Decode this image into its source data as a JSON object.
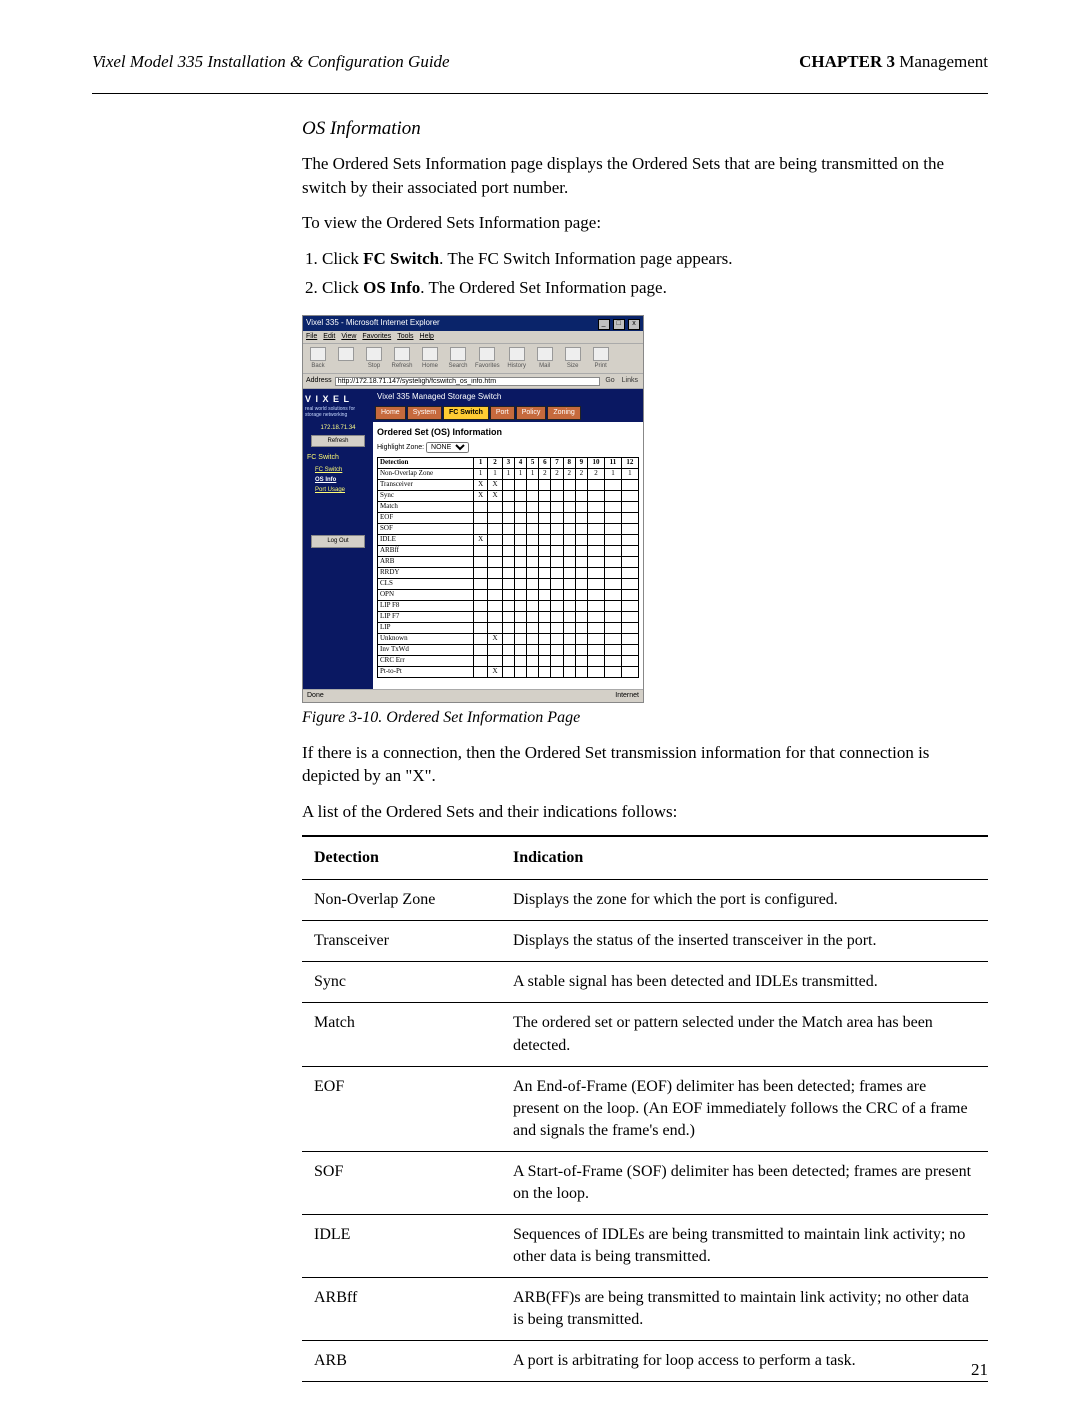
{
  "header": {
    "left": "Vixel Model 335 Installation & Configuration Guide",
    "right_bold": "CHAPTER 3",
    "right_rest": " Management"
  },
  "section_heading": "OS Information",
  "para1": "The Ordered Sets Information page displays the Ordered Sets that are being transmitted on the switch by their associated port number.",
  "para2": "To view the Ordered Sets Information page:",
  "steps": [
    {
      "pre": "Click ",
      "bold": "FC Switch",
      "post": ". The FC Switch Information page appears."
    },
    {
      "pre": "Click ",
      "bold": "OS Info",
      "post": ". The Ordered Set Information page."
    }
  ],
  "fig_caption": "Figure 3-10. Ordered Set Information Page",
  "para3": "If there is a connection, then the Ordered Set transmission information for that connection is depicted by an \"X\".",
  "para4": "A list of the Ordered Sets and their indications follows:",
  "ind_table": {
    "headers": [
      "Detection",
      "Indication"
    ],
    "rows": [
      [
        "Non-Overlap Zone",
        "Displays the zone for which the port is configured."
      ],
      [
        "Transceiver",
        "Displays the status of the inserted transceiver in the port."
      ],
      [
        "Sync",
        "A stable signal has been detected and IDLEs transmitted."
      ],
      [
        "Match",
        "The ordered set or pattern selected under the Match area has been detected."
      ],
      [
        "EOF",
        "An End-of-Frame (EOF) delimiter has been detected; frames are present on the loop. (An EOF immediately follows the CRC of a frame and signals the frame's end.)"
      ],
      [
        "SOF",
        "A Start-of-Frame (SOF) delimiter has been detected; frames are present on the loop."
      ],
      [
        "IDLE",
        "Sequences of IDLEs are being transmitted to maintain link activity; no other data is being transmitted."
      ],
      [
        "ARBff",
        "ARB(FF)s are being transmitted to maintain link activity; no other data is being transmitted."
      ],
      [
        "ARB",
        "A port is arbitrating for loop access to perform a task."
      ]
    ]
  },
  "page_number": "21",
  "screenshot": {
    "window_title": "Vixel 335 - Microsoft Internet Explorer",
    "menus": [
      "File",
      "Edit",
      "View",
      "Favorites",
      "Tools",
      "Help"
    ],
    "toolbar": [
      "Back",
      "",
      "Stop",
      "Refresh",
      "Home",
      "Search",
      "Favorites",
      "History",
      "Mail",
      "Size",
      "Print"
    ],
    "address_label": "Address",
    "address_url": "http://172.18.71.147/systeligh/fcswitch_os_info.htm",
    "go": "Go",
    "links": "Links",
    "sidebar": {
      "brand": "V I X E L",
      "tagline": "real world solutions\nfor storage networking",
      "ip": "172.18.71.34",
      "refresh": "Refresh",
      "cat": "FC Switch",
      "items": [
        {
          "label": "FC Switch",
          "active": false
        },
        {
          "label": "OS Info",
          "active": true
        },
        {
          "label": "Port Usage",
          "active": false
        }
      ],
      "logout": "Log Out"
    },
    "mast": "Vixel 335 Managed Storage Switch",
    "tabs": [
      "Home",
      "System",
      "FC Switch",
      "Port",
      "Policy",
      "Zoning"
    ],
    "active_tab": "FC Switch",
    "section_title": "Ordered Set (OS) Information",
    "highlight_label": "Highlight Zone:",
    "highlight_value": "NONE",
    "os_table": {
      "col_header": "Detection",
      "ports": [
        "1",
        "2",
        "3",
        "4",
        "5",
        "6",
        "7",
        "8",
        "9",
        "10",
        "11",
        "12"
      ],
      "rows": [
        {
          "label": "Non-Overlap Zone",
          "cells": [
            "1",
            "1",
            "1",
            "1",
            "1",
            "2",
            "2",
            "2",
            "2",
            "2",
            "1",
            "1"
          ]
        },
        {
          "label": "Transceiver",
          "cells": [
            "X",
            "X",
            "",
            "",
            "",
            "",
            "",
            "",
            "",
            "",
            "",
            ""
          ]
        },
        {
          "label": "Sync",
          "cells": [
            "X",
            "X",
            "",
            "",
            "",
            "",
            "",
            "",
            "",
            "",
            "",
            ""
          ]
        },
        {
          "label": "Match",
          "cells": [
            "",
            "",
            "",
            "",
            "",
            "",
            "",
            "",
            "",
            "",
            "",
            ""
          ]
        },
        {
          "label": "EOF",
          "cells": [
            "",
            "",
            "",
            "",
            "",
            "",
            "",
            "",
            "",
            "",
            "",
            ""
          ]
        },
        {
          "label": "SOF",
          "cells": [
            "",
            "",
            "",
            "",
            "",
            "",
            "",
            "",
            "",
            "",
            "",
            ""
          ]
        },
        {
          "label": "IDLE",
          "cells": [
            "X",
            "",
            "",
            "",
            "",
            "",
            "",
            "",
            "",
            "",
            "",
            ""
          ]
        },
        {
          "label": "ARBff",
          "cells": [
            "",
            "",
            "",
            "",
            "",
            "",
            "",
            "",
            "",
            "",
            "",
            ""
          ]
        },
        {
          "label": "ARB",
          "cells": [
            "",
            "",
            "",
            "",
            "",
            "",
            "",
            "",
            "",
            "",
            "",
            ""
          ]
        },
        {
          "label": "RRDY",
          "cells": [
            "",
            "",
            "",
            "",
            "",
            "",
            "",
            "",
            "",
            "",
            "",
            ""
          ]
        },
        {
          "label": "CLS",
          "cells": [
            "",
            "",
            "",
            "",
            "",
            "",
            "",
            "",
            "",
            "",
            "",
            ""
          ]
        },
        {
          "label": "OPN",
          "cells": [
            "",
            "",
            "",
            "",
            "",
            "",
            "",
            "",
            "",
            "",
            "",
            ""
          ]
        },
        {
          "label": "LIP F8",
          "cells": [
            "",
            "",
            "",
            "",
            "",
            "",
            "",
            "",
            "",
            "",
            "",
            ""
          ]
        },
        {
          "label": "LIP F7",
          "cells": [
            "",
            "",
            "",
            "",
            "",
            "",
            "",
            "",
            "",
            "",
            "",
            ""
          ]
        },
        {
          "label": "LIP",
          "cells": [
            "",
            "",
            "",
            "",
            "",
            "",
            "",
            "",
            "",
            "",
            "",
            ""
          ]
        },
        {
          "label": "Unknown",
          "cells": [
            "",
            "X",
            "",
            "",
            "",
            "",
            "",
            "",
            "",
            "",
            "",
            ""
          ]
        },
        {
          "label": "Inv TxWd",
          "cells": [
            "",
            "",
            "",
            "",
            "",
            "",
            "",
            "",
            "",
            "",
            "",
            ""
          ]
        },
        {
          "label": "CRC Err",
          "cells": [
            "",
            "",
            "",
            "",
            "",
            "",
            "",
            "",
            "",
            "",
            "",
            ""
          ]
        },
        {
          "label": "Pt-to-Pt",
          "cells": [
            "",
            "X",
            "",
            "",
            "",
            "",
            "",
            "",
            "",
            "",
            "",
            ""
          ]
        }
      ]
    },
    "status_left": "Done",
    "status_right": "Internet"
  }
}
